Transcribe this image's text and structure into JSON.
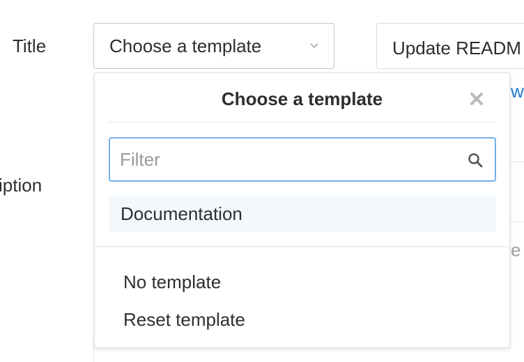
{
  "form": {
    "title_label": "Title",
    "description_label": "iption",
    "title_value": "Update READM",
    "link_fragment": "wi",
    "text_fragment": "e"
  },
  "template_select": {
    "label": "Choose a template",
    "icon": "chevron-down-icon"
  },
  "dropdown": {
    "title": "Choose a template",
    "close_icon": "close-icon",
    "filter_placeholder": "Filter",
    "filter_value": "",
    "search_icon": "search-icon",
    "items": [
      {
        "label": "Documentation",
        "highlighted": true
      }
    ],
    "footer_items": [
      {
        "label": "No template"
      },
      {
        "label": "Reset template"
      }
    ]
  },
  "colors": {
    "link": "#1f78d1",
    "focus_border": "#73afea",
    "highlight_bg": "#f3f8fc",
    "text": "#2e2e2e"
  }
}
